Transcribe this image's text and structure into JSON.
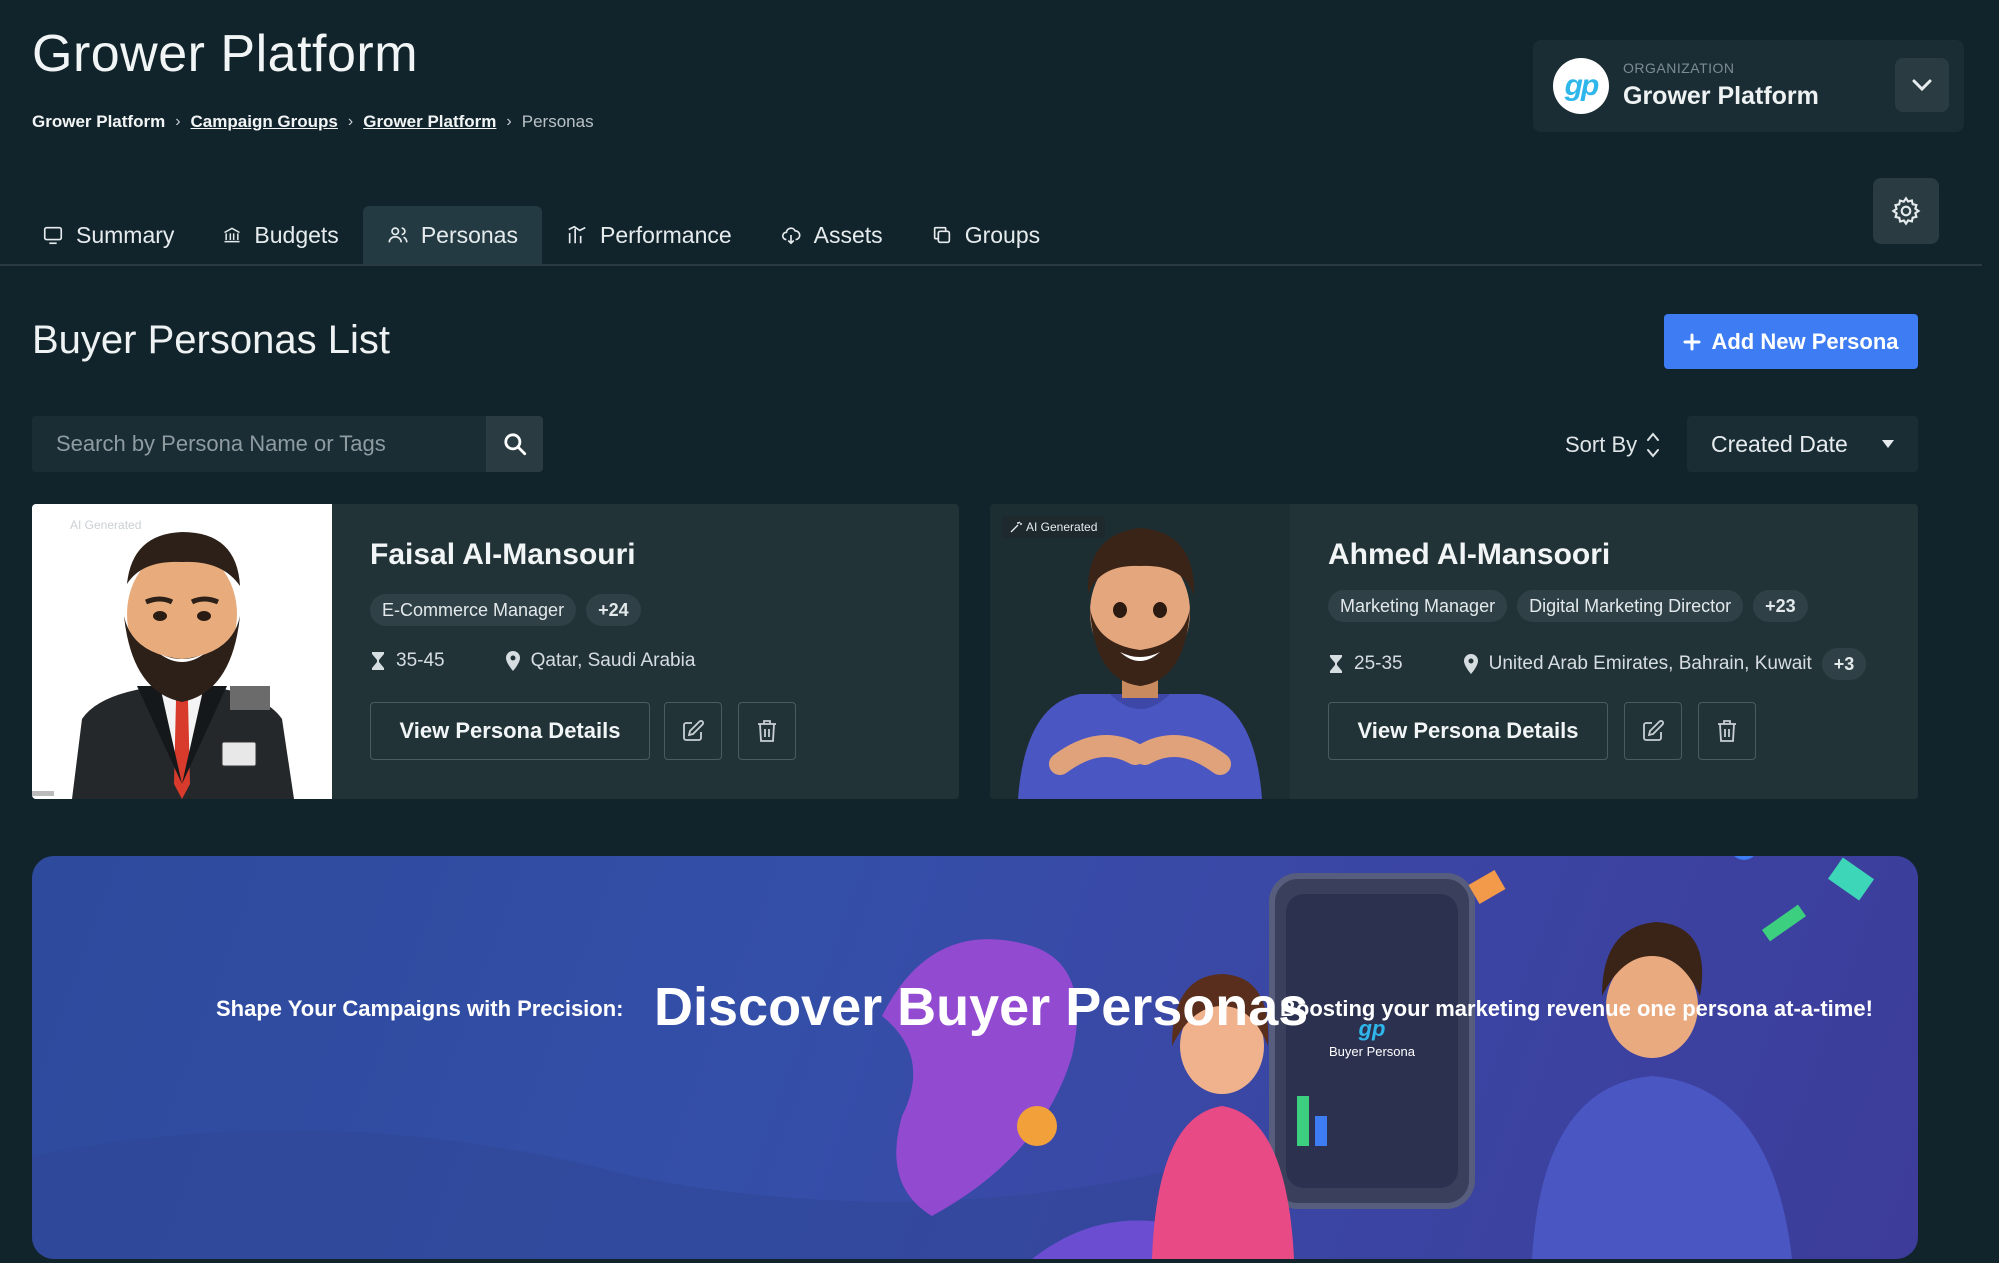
{
  "app": {
    "title": "Grower Platform"
  },
  "breadcrumb": [
    {
      "label": "Grower Platform"
    },
    {
      "label": "Campaign Groups"
    },
    {
      "label": "Grower Platform"
    },
    {
      "label": "Personas"
    }
  ],
  "organization": {
    "label": "ORGANIZATION",
    "name": "Grower Platform",
    "logo_text": "gp"
  },
  "tabs": [
    {
      "label": "Summary",
      "icon": "monitor-icon"
    },
    {
      "label": "Budgets",
      "icon": "bank-icon"
    },
    {
      "label": "Personas",
      "icon": "users-icon",
      "active": true
    },
    {
      "label": "Performance",
      "icon": "bar-chart-icon"
    },
    {
      "label": "Assets",
      "icon": "cloud-icon"
    },
    {
      "label": "Groups",
      "icon": "copy-icon"
    }
  ],
  "page": {
    "title": "Buyer Personas List",
    "add_button": "Add New Persona"
  },
  "search": {
    "placeholder": "Search by Persona Name or Tags"
  },
  "sort": {
    "label": "Sort By",
    "value": "Created Date"
  },
  "personas": [
    {
      "name": "Faisal Al-Mansouri",
      "tags": [
        "E-Commerce Manager"
      ],
      "more_tags": "+24",
      "age": "35-45",
      "location": "Qatar, Saudi Arabia",
      "badge": "AI Generated",
      "view_label": "View Persona Details"
    },
    {
      "name": "Ahmed Al-Mansoori",
      "tags": [
        "Marketing Manager",
        "Digital Marketing Director"
      ],
      "more_tags": "+23",
      "age": "25-35",
      "location": "United Arab Emirates, Bahrain, Kuwait",
      "more_locations": "+3",
      "badge": "AI Generated",
      "view_label": "View Persona Details"
    }
  ],
  "banner": {
    "left": "Shape Your Campaigns with Precision:",
    "title": "Discover Buyer Personas",
    "right": "Boosting your marketing revenue one persona at-a-time!",
    "phone_label": "Buyer Persona",
    "phone_logo": "gp"
  },
  "colors": {
    "background": "#12242b",
    "accent": "#3d7cf2",
    "card": "#223338"
  }
}
